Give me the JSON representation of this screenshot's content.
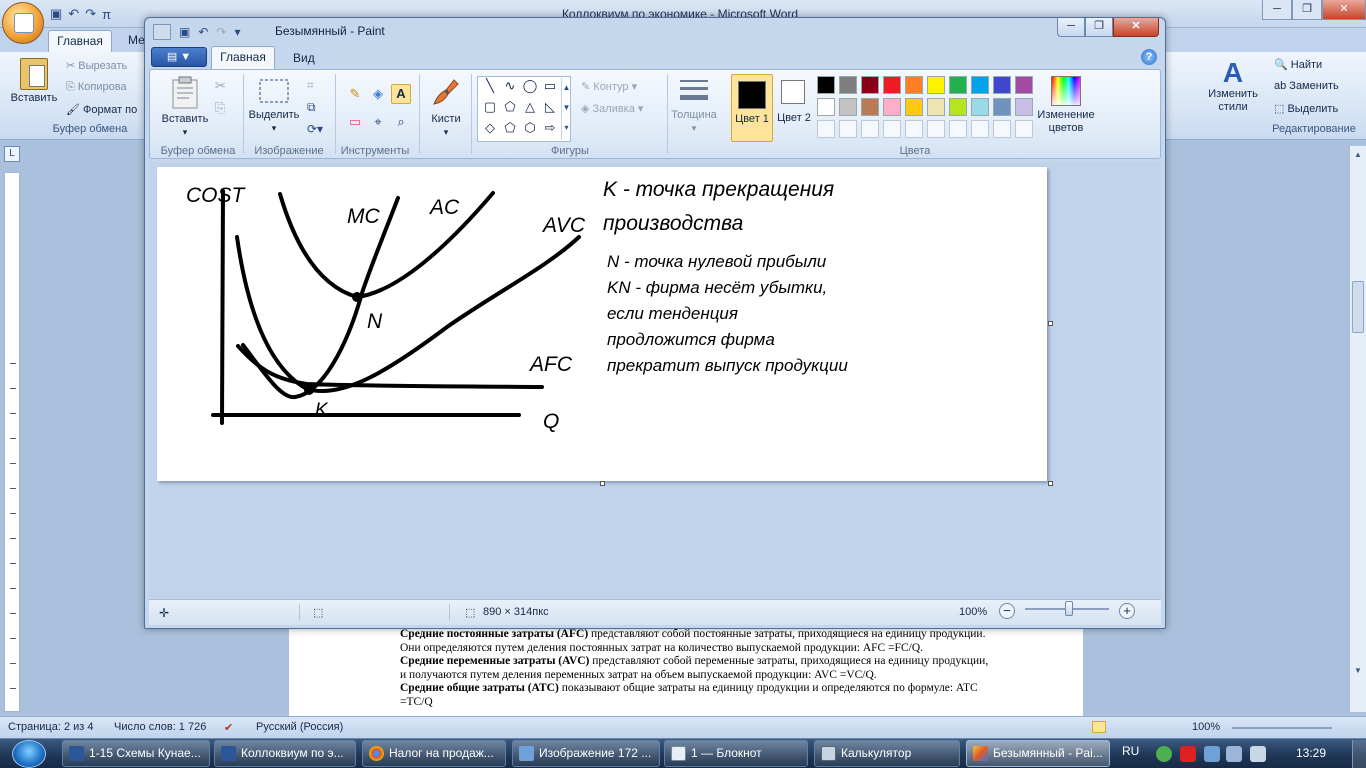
{
  "word": {
    "title": "Коллоквиум по экономике - Microsoft Word",
    "tabs": [
      "Главная",
      "Ме"
    ],
    "clipboard": {
      "paste": "Вставить",
      "cut": "Вырезать",
      "copy": "Копирова",
      "format": "Формат по",
      "group": "Буфер обмена"
    },
    "styles_button": "Изменить стили",
    "editing": {
      "find": "Найти",
      "replace": "Заменить",
      "select": "Выделить",
      "group": "Редактирование"
    },
    "document_lines": [
      {
        "bold": "Средние постоянные затраты (AFC)",
        "text": " представляют собой постоянные затраты, приходящиеся на единицу продукции."
      },
      {
        "bold": "",
        "text": "Они определяются путем деления постоянных затрат на количество выпускаемой продукции: AFC =FC/Q."
      },
      {
        "bold": "Средние переменные затраты (AVC)",
        "text": " представляют собой переменные затраты, приходящиеся на единицу продукции,"
      },
      {
        "bold": "",
        "text": "и получаются путем деления переменных затрат на объем выпускаемой продукции: AVC =VC/Q."
      },
      {
        "bold": "Средние общие затраты (ATC)",
        "text": " показывают общие затраты на единицу продукции и определяются по формуле: ATC"
      },
      {
        "bold": "",
        "text": "=TC/Q"
      }
    ],
    "status": {
      "page": "Страница: 2 из 4",
      "words": "Число слов: 1 726",
      "language": "Русский (Россия)",
      "zoom": "100%"
    }
  },
  "paint": {
    "title": "Безымянный - Paint",
    "menu_button": "▼",
    "tabs": [
      "Главная",
      "Вид"
    ],
    "clipboard": {
      "paste": "Вставить",
      "group": "Буфер обмена"
    },
    "image": {
      "select": "Выделить",
      "group": "Изображение"
    },
    "tools_group": "Инструменты",
    "brushes": "Кисти",
    "shapes": {
      "outline": "Контур",
      "fill": "Заливка",
      "group": "Фигуры"
    },
    "size": "Толщина",
    "color1": "Цвет 1",
    "color2": "Цвет 2",
    "colors_group": "Цвета",
    "edit_colors": "Изменение цветов",
    "palette": [
      "#000000",
      "#7f7f7f",
      "#880015",
      "#ed1c24",
      "#ff7f27",
      "#fff200",
      "#22b14c",
      "#00a2e8",
      "#3f48cc",
      "#a349a4",
      "#ffffff",
      "#c3c3c3",
      "#b97a57",
      "#ffaec9",
      "#ffc90e",
      "#efe4b0",
      "#b5e61d",
      "#99d9ea",
      "#7092be",
      "#c8bfe7"
    ],
    "status": {
      "image_size": "890 × 314пкс",
      "zoom": "100%"
    }
  },
  "drawing": {
    "y_axis_label": "COST",
    "x_axis_label": "Q",
    "curve_labels": [
      "MC",
      "AC",
      "AVC",
      "AFC"
    ],
    "point_n": "N",
    "point_k": "K",
    "note_title": [
      "K - точка прекращения",
      "производства"
    ],
    "note_lines": [
      "N - точка нулевой прибыли",
      "KN - фирма несёт убытки,",
      "если тенденция",
      "продложится фирма",
      "прекратит выпуск продукции"
    ]
  },
  "taskbar": {
    "items": [
      "1-15 Схемы Кунае...",
      "Коллоквиум по э...",
      "Налог на продаж...",
      "Изображение 172 ...",
      "1 — Блокнот",
      "Калькулятор",
      "Безымянный - Pai..."
    ],
    "language": "RU",
    "time": "13:29"
  }
}
